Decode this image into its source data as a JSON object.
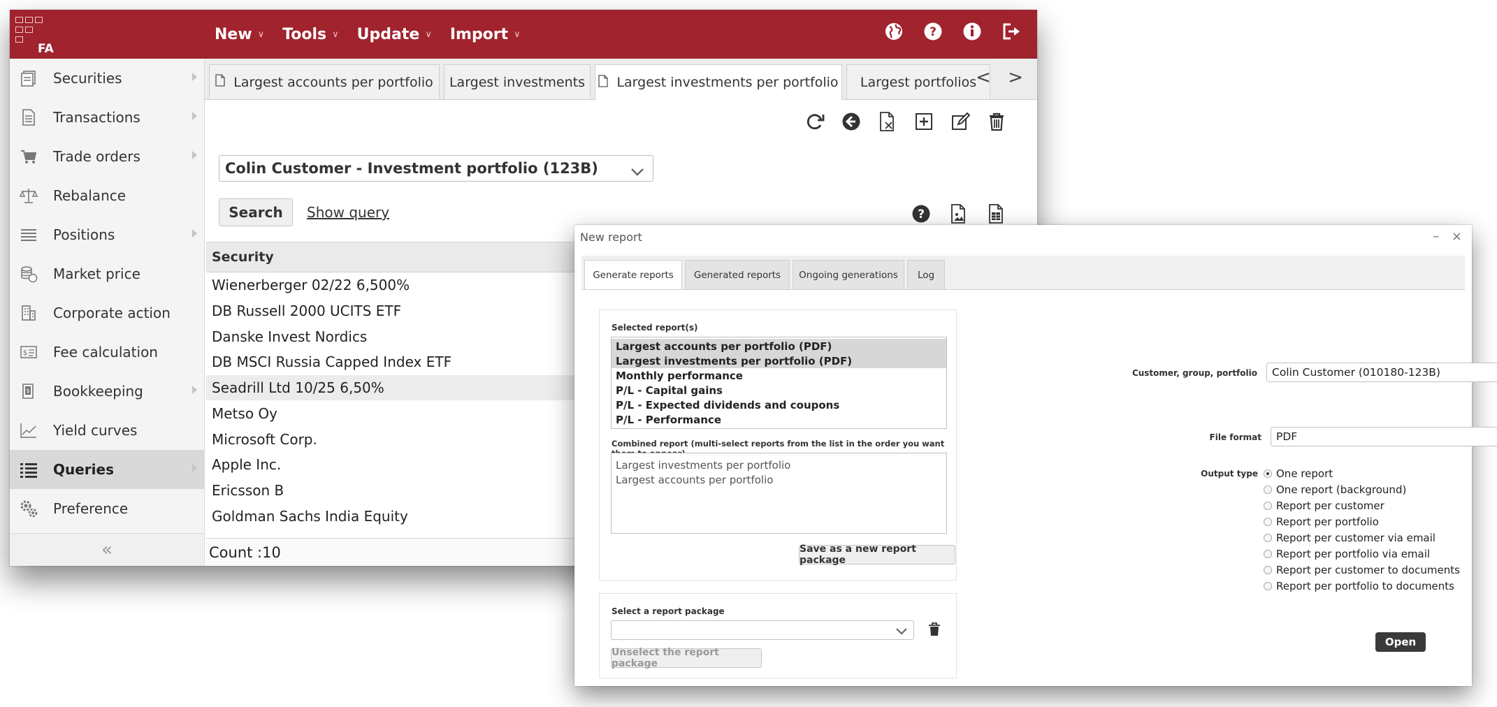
{
  "topbar": {
    "logo_text": "FA",
    "menu": [
      {
        "label": "New"
      },
      {
        "label": "Tools"
      },
      {
        "label": "Update"
      },
      {
        "label": "Import"
      }
    ],
    "icons": [
      "globe-icon",
      "help-icon",
      "info-icon",
      "logout-icon"
    ],
    "accent_color": "#a0232e"
  },
  "sidebar": {
    "items": [
      {
        "label": "Securities",
        "icon": "securities-icon",
        "arrow": true
      },
      {
        "label": "Transactions",
        "icon": "document-icon",
        "arrow": true
      },
      {
        "label": "Trade orders",
        "icon": "cart-icon",
        "arrow": true
      },
      {
        "label": "Rebalance",
        "icon": "scale-icon",
        "arrow": false
      },
      {
        "label": "Positions",
        "icon": "list-lines-icon",
        "arrow": true
      },
      {
        "label": "Market price",
        "icon": "coins-icon",
        "arrow": false
      },
      {
        "label": "Corporate action",
        "icon": "building-icon",
        "arrow": false
      },
      {
        "label": "Fee calculation",
        "icon": "fee-icon",
        "arrow": false
      },
      {
        "label": "Bookkeeping",
        "icon": "book-icon",
        "arrow": true
      },
      {
        "label": "Yield curves",
        "icon": "chart-line-icon",
        "arrow": false
      },
      {
        "label": "Queries",
        "icon": "queries-list-icon",
        "arrow": true,
        "active": true
      },
      {
        "label": "Preference",
        "icon": "gears-icon",
        "arrow": false
      }
    ],
    "collapse_glyph": "«"
  },
  "tabs": [
    {
      "label": "Largest accounts per portfolio",
      "doc": true
    },
    {
      "label": "Largest investments",
      "doc": false
    },
    {
      "label": "Largest investments per portfolio",
      "doc": true,
      "active": true
    },
    {
      "label": "Largest portfolios",
      "doc": false
    }
  ],
  "tab_nav": "< >",
  "query": {
    "portfolio_value": "Colin Customer - Investment portfolio (123B)",
    "search_label": "Search",
    "show_query_label": "Show query",
    "column_security": "Security",
    "rows": [
      "Wienerberger 02/22 6,500%",
      "DB Russell 2000 UCITS ETF",
      "Danske Invest Nordics",
      "DB MSCI Russia Capped Index ETF",
      "Seadrill Ltd 10/25 6,50%",
      "Metso Oy",
      "Microsoft Corp.",
      "Apple Inc.",
      "Ericsson B",
      "Goldman Sachs India Equity"
    ],
    "count_label": "Count :10"
  },
  "dialog": {
    "title": "New report",
    "controls": "– ×",
    "tabs": [
      "Generate reports",
      "Generated reports",
      "Ongoing generations",
      "Log"
    ],
    "selected_reports_label": "Selected report(s)",
    "reports": [
      {
        "label": "Largest accounts per portfolio (PDF)",
        "selected": true
      },
      {
        "label": "Largest investments per portfolio (PDF)",
        "selected": true
      },
      {
        "label": "Monthly performance",
        "selected": false
      },
      {
        "label": "P/L - Capital gains",
        "selected": false
      },
      {
        "label": "P/L - Expected dividends and coupons",
        "selected": false
      },
      {
        "label": "P/L - Performance",
        "selected": false
      }
    ],
    "combined_label": "Combined report (multi-select reports from the list in the order you want them to appear)",
    "combined_items": [
      "Largest investments per portfolio",
      "Largest accounts per portfolio"
    ],
    "save_package_label": "Save as a new report package",
    "select_package_label": "Select a report package",
    "select_package_value": "",
    "unselect_label": "Unselect the report package",
    "customer_label": "Customer, group, portfolio",
    "customer_value": "Colin Customer (010180-123B)",
    "file_format_label": "File format",
    "file_format_value": "PDF",
    "output_type_label": "Output type",
    "output_options": [
      {
        "label": "One report",
        "checked": true
      },
      {
        "label": "One report (background)",
        "checked": false
      },
      {
        "label": "Report per customer",
        "checked": false
      },
      {
        "label": "Report per portfolio",
        "checked": false
      },
      {
        "label": "Report per customer via email",
        "checked": false
      },
      {
        "label": "Report per portfolio via email",
        "checked": false
      },
      {
        "label": "Report per customer to documents",
        "checked": false
      },
      {
        "label": "Report per portfolio to documents",
        "checked": false
      }
    ],
    "open_label": "Open"
  }
}
